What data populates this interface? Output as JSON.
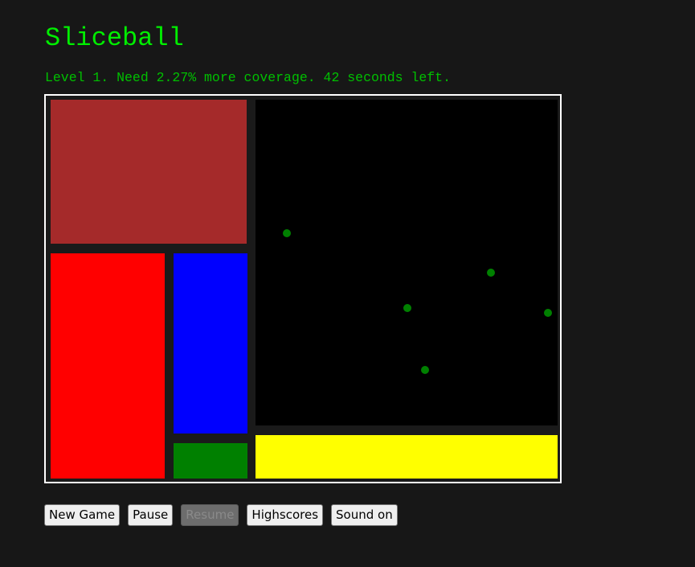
{
  "game": {
    "title": "Sliceball",
    "status": "Level 1. Need 2.27% more coverage. 42 seconds left."
  },
  "board": {
    "background_color": "#000000",
    "border_color": "#ffffff",
    "filled_regions": [
      {
        "color": "#a52a2a"
      },
      {
        "color": "#ff0000"
      },
      {
        "color": "#0000ff"
      },
      {
        "color": "#008000"
      },
      {
        "color": "#ffff00"
      }
    ],
    "ball_count": 5,
    "ball_color": "#008000"
  },
  "controls": {
    "new_game": "New Game",
    "pause": "Pause",
    "resume": "Resume",
    "resume_disabled": true,
    "highscores": "Highscores",
    "sound": "Sound on"
  }
}
